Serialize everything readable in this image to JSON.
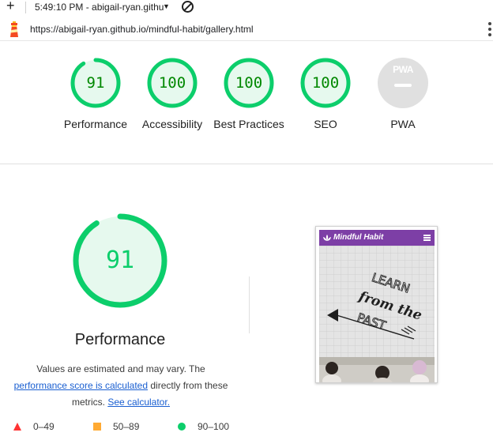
{
  "toolbar": {
    "new_tab_symbol": "+",
    "session_label": "5:49:10 PM - abigail-ryan.githu",
    "dropdown_icon": "caret-down-icon",
    "block_icon": "blocked-icon"
  },
  "urlbar": {
    "logo_icon": "lighthouse-icon",
    "url": "https://abigail-ryan.github.io/mindful-habit/gallery.html",
    "menu_icon": "kebab-menu-icon"
  },
  "categories": [
    {
      "score": 91,
      "label": "Performance"
    },
    {
      "score": 100,
      "label": "Accessibility"
    },
    {
      "score": 100,
      "label": "Best Practices"
    },
    {
      "score": 100,
      "label": "SEO"
    },
    {
      "score": null,
      "label": "PWA",
      "badge": "PWA"
    }
  ],
  "colors": {
    "pass": "#0cce6b",
    "pass_text": "#008800",
    "average": "#ffaa33",
    "fail": "#ff3333",
    "pwa_gray": "#e0e0e0",
    "brand_purple": "#7d3fa6"
  },
  "performance": {
    "score": 91,
    "title": "Performance",
    "note_prefix": "Values are estimated and may vary. The",
    "note_link": "performance score is calculated",
    "note_mid": "directly from these metrics.",
    "calc_link": "See calculator."
  },
  "legend": [
    {
      "shape": "triangle",
      "range": "0–49"
    },
    {
      "shape": "square",
      "range": "50–89"
    },
    {
      "shape": "circle",
      "range": "90–100"
    }
  ],
  "screenshot": {
    "brand": "Mindful Habit",
    "menu_icon": "hamburger-icon",
    "image_text": [
      "LEARN",
      "from the",
      "PAST"
    ]
  }
}
